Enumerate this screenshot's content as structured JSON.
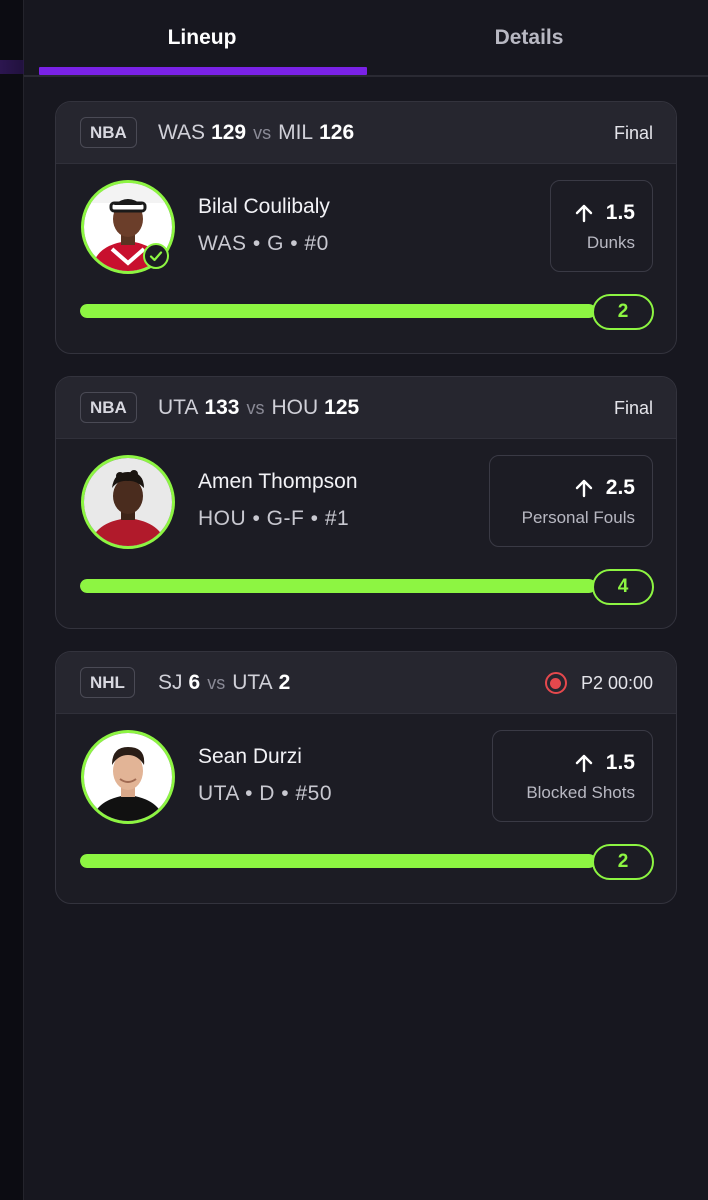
{
  "tabs": [
    {
      "label": "Lineup",
      "active": true
    },
    {
      "label": "Details",
      "active": false
    }
  ],
  "colors": {
    "accent": "#7a22e6",
    "success": "#8df542",
    "live": "#e5484d",
    "background": "#17171f",
    "card": "#1c1c24"
  },
  "picks": [
    {
      "league": "NBA",
      "home_team": "WAS",
      "home_score": "129",
      "vs": "vs",
      "away_team": "MIL",
      "away_score": "126",
      "status": "Final",
      "live": false,
      "player_name": "Bilal Coulibaly",
      "player_meta": "WAS • G • #0",
      "hit": true,
      "direction_icon": "arrow-up-icon",
      "line": "1.5",
      "stat": "Dunks",
      "result": "2",
      "progress": 1.0
    },
    {
      "league": "NBA",
      "home_team": "UTA",
      "home_score": "133",
      "vs": "vs",
      "away_team": "HOU",
      "away_score": "125",
      "status": "Final",
      "live": false,
      "player_name": "Amen Thompson",
      "player_meta": "HOU • G-F • #1",
      "hit": false,
      "direction_icon": "arrow-up-icon",
      "line": "2.5",
      "stat": "Personal Fouls",
      "result": "4",
      "progress": 1.0
    },
    {
      "league": "NHL",
      "home_team": "SJ",
      "home_score": "6",
      "vs": "vs",
      "away_team": "UTA",
      "away_score": "2",
      "status": "P2 00:00",
      "live": true,
      "player_name": "Sean Durzi",
      "player_meta": "UTA • D • #50",
      "hit": false,
      "direction_icon": "arrow-up-icon",
      "line": "1.5",
      "stat": "Blocked Shots",
      "result": "2",
      "progress": 1.0
    }
  ]
}
